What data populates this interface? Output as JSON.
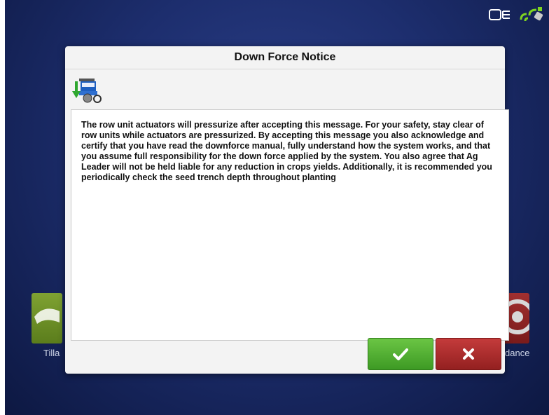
{
  "dialog": {
    "title": "Down Force Notice",
    "message": "The row unit actuators will pressurize after accepting this message. For your safety, stay clear of row units while actuators are pressurized. By accepting this message you also acknowledge and certify that you have read the downforce manual, fully understand how the system works, and that you assume full responsibility for the down force applied by the system. You also agree that Ag Leader will not be held liable for any reduction in crops yields. Additionally, it is recommended you periodically check the seed trench depth throughout planting",
    "icon": "planter-downforce-icon",
    "accept_icon": "checkmark-icon",
    "cancel_icon": "x-icon"
  },
  "background": {
    "left_tile_label": "Tilla",
    "right_tile_label": "dance"
  },
  "status_bar": {
    "icons": [
      "display-module-icon",
      "gps-signal-icon"
    ]
  },
  "colors": {
    "accept": "#4caf2f",
    "cancel": "#b22a2a",
    "screen_bg": "#1d2e6e"
  }
}
